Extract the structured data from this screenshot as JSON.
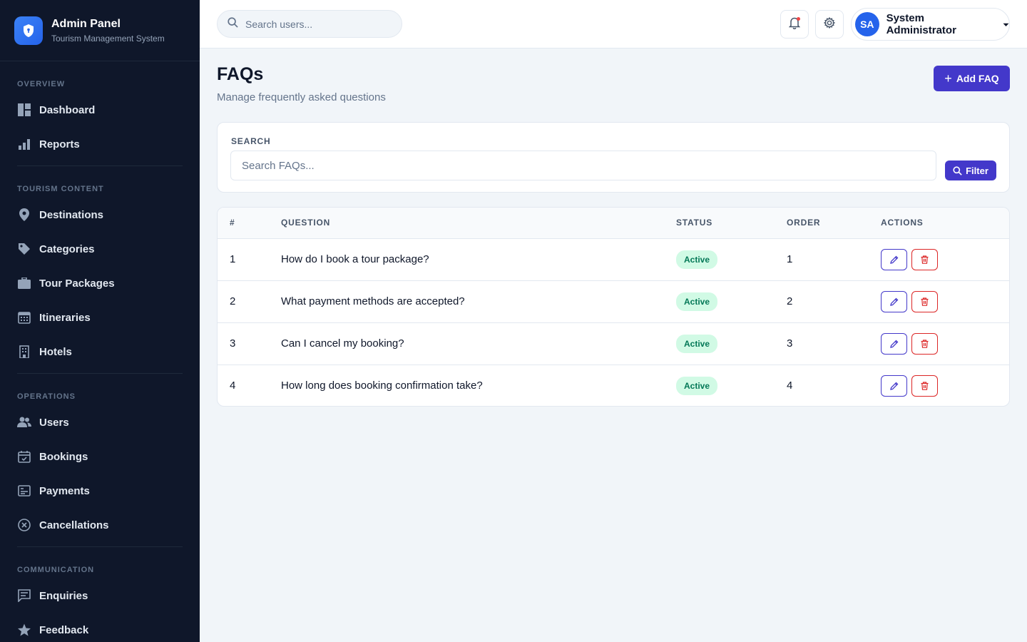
{
  "brand": {
    "title": "Admin Panel",
    "subtitle": "Tourism Management System"
  },
  "sidebar": {
    "sections": [
      {
        "heading": "OVERVIEW",
        "items": [
          {
            "label": "Dashboard",
            "icon": "dashboard-icon"
          },
          {
            "label": "Reports",
            "icon": "bar-chart-icon"
          }
        ]
      },
      {
        "heading": "TOURISM CONTENT",
        "items": [
          {
            "label": "Destinations",
            "icon": "map-pin-icon"
          },
          {
            "label": "Categories",
            "icon": "tag-icon"
          },
          {
            "label": "Tour Packages",
            "icon": "briefcase-icon"
          },
          {
            "label": "Itineraries",
            "icon": "calendar-grid-icon"
          },
          {
            "label": "Hotels",
            "icon": "building-icon"
          }
        ]
      },
      {
        "heading": "OPERATIONS",
        "items": [
          {
            "label": "Users",
            "icon": "users-icon"
          },
          {
            "label": "Bookings",
            "icon": "calendar-check-icon"
          },
          {
            "label": "Payments",
            "icon": "payment-card-icon"
          },
          {
            "label": "Cancellations",
            "icon": "x-circle-icon"
          }
        ]
      },
      {
        "heading": "COMMUNICATION",
        "items": [
          {
            "label": "Enquiries",
            "icon": "message-icon"
          },
          {
            "label": "Feedback",
            "icon": "star-icon"
          }
        ]
      }
    ]
  },
  "topbar": {
    "search_placeholder": "Search users...",
    "user": {
      "initials": "SA",
      "name": "System Administrator"
    }
  },
  "page": {
    "title": "FAQs",
    "subtitle": "Manage frequently asked questions",
    "add_label": "Add FAQ"
  },
  "filters": {
    "label": "SEARCH",
    "placeholder": "Search FAQs...",
    "filter_label": "Filter"
  },
  "table": {
    "headers": {
      "num": "#",
      "question": "QUESTION",
      "status": "STATUS",
      "order": "ORDER",
      "actions": "ACTIONS"
    },
    "rows": [
      {
        "num": "1",
        "question": "How do I book a tour package?",
        "status": "Active",
        "order": "1"
      },
      {
        "num": "2",
        "question": "What payment methods are accepted?",
        "status": "Active",
        "order": "2"
      },
      {
        "num": "3",
        "question": "Can I cancel my booking?",
        "status": "Active",
        "order": "3"
      },
      {
        "num": "4",
        "question": "How long does booking confirmation take?",
        "status": "Active",
        "order": "4"
      }
    ]
  },
  "colors": {
    "sidebar_bg": "#0f172a",
    "accent": "#4338ca",
    "active_badge_bg": "#d1fae5",
    "active_badge_text": "#047857",
    "danger": "#dc2626"
  }
}
